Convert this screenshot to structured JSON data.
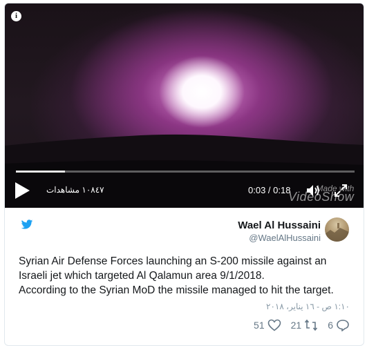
{
  "video": {
    "views": "١٠٨٤٧ مشاهدات",
    "time": "0:03 / 0:18",
    "progress": 0.145,
    "watermark_line1": "Made with",
    "watermark_line2": "VideoShow"
  },
  "tweet": {
    "author_name": "Wael Al Hussaini",
    "author_handle": "@WaelAlHussaini",
    "text_line1": "Syrian Air Defense Forces launching an S-200 missile against an",
    "text_line2": "Israeli jet which targeted Al Qalamun area 9/1/2018.",
    "text_line3": "According to the Syrian MoD the missile managed to hit the target.",
    "date": "١:١٠ ص - ١٦ يناير، ٢٠١٨",
    "likes": "51",
    "retweets": "21",
    "replies": "6"
  },
  "colors": {
    "twitter_blue": "#1da1f2",
    "text_dark": "#14171a",
    "text_muted": "#657786"
  },
  "icons": [
    "info-icon",
    "play-icon",
    "volume-icon",
    "fullscreen-icon",
    "twitter-bird-icon",
    "heart-icon",
    "retweet-icon",
    "reply-icon"
  ]
}
